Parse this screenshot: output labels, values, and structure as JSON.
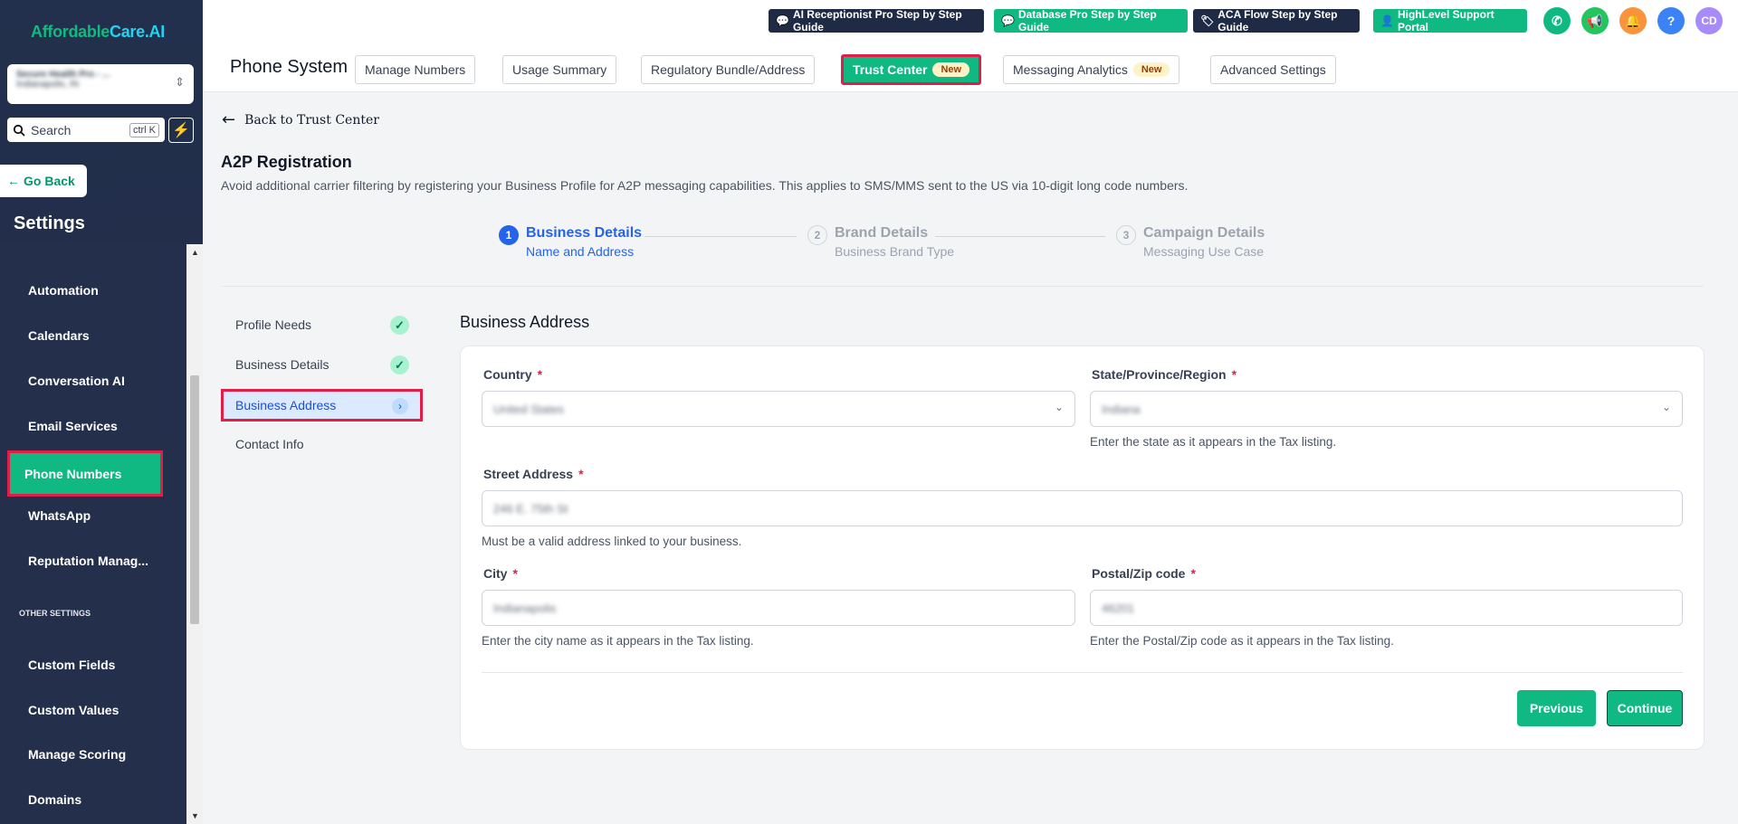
{
  "sidebar": {
    "logo": {
      "part1": "Affordable",
      "part2": "Care.AI"
    },
    "account": {
      "name": "Secure Health Pro - ...",
      "location": "Indianapolis, IN"
    },
    "search": {
      "label": "Search",
      "shortcut": "ctrl K"
    },
    "go_back": "Go Back",
    "title": "Settings",
    "items": [
      "Automation",
      "Calendars",
      "Conversation AI",
      "Email Services",
      "Phone Numbers",
      "WhatsApp",
      "Reputation Manag..."
    ],
    "active_item": "Phone Numbers",
    "other_settings_label": "OTHER SETTINGS",
    "other_items": [
      "Custom Fields",
      "Custom Values",
      "Manage Scoring",
      "Domains"
    ]
  },
  "topbar": {
    "buttons": [
      "AI Receptionist Pro Step by Step Guide",
      "Database Pro Step by Step Guide",
      "ACA Flow Step by Step Guide",
      "HighLevel Support Portal"
    ],
    "avatar": "CD"
  },
  "subbar": {
    "title": "Phone System",
    "tabs": [
      "Manage Numbers",
      "Usage Summary",
      "Regulatory Bundle/Address",
      "Trust Center",
      "Messaging Analytics",
      "Advanced Settings"
    ],
    "new_badge": "New"
  },
  "main": {
    "back_link": "Back to Trust Center",
    "title": "A2P Registration",
    "description": "Avoid additional carrier filtering by registering your Business Profile for A2P messaging capabilities. This applies to SMS/MMS sent to the US via 10-digit long code numbers.",
    "steps": [
      {
        "num": "1",
        "title": "Business Details",
        "subtitle": "Name and Address"
      },
      {
        "num": "2",
        "title": "Brand Details",
        "subtitle": "Business Brand Type"
      },
      {
        "num": "3",
        "title": "Campaign Details",
        "subtitle": "Messaging Use Case"
      }
    ],
    "subnav": [
      "Profile Needs",
      "Business Details",
      "Business Address",
      "Contact Info"
    ],
    "section_title": "Business Address",
    "form": {
      "country": {
        "label": "Country",
        "value": "United States"
      },
      "state": {
        "label": "State/Province/Region",
        "value": "Indiana",
        "help": "Enter the state as it appears in the Tax listing."
      },
      "street": {
        "label": "Street Address",
        "value": "246 E. 75th St",
        "help": "Must be a valid address linked to your business."
      },
      "city": {
        "label": "City",
        "value": "Indianapolis",
        "help": "Enter the city name as it appears in the Tax listing."
      },
      "zip": {
        "label": "Postal/Zip code",
        "value": "46201",
        "help": "Enter the Postal/Zip code as it appears in the Tax listing."
      },
      "required_mark": "*"
    },
    "buttons": {
      "previous": "Previous",
      "continue": "Continue"
    }
  },
  "colors": {
    "accent": "#10b981",
    "sidebar": "#23304d",
    "primary_blue": "#2563eb",
    "highlight": "#e11d48"
  }
}
